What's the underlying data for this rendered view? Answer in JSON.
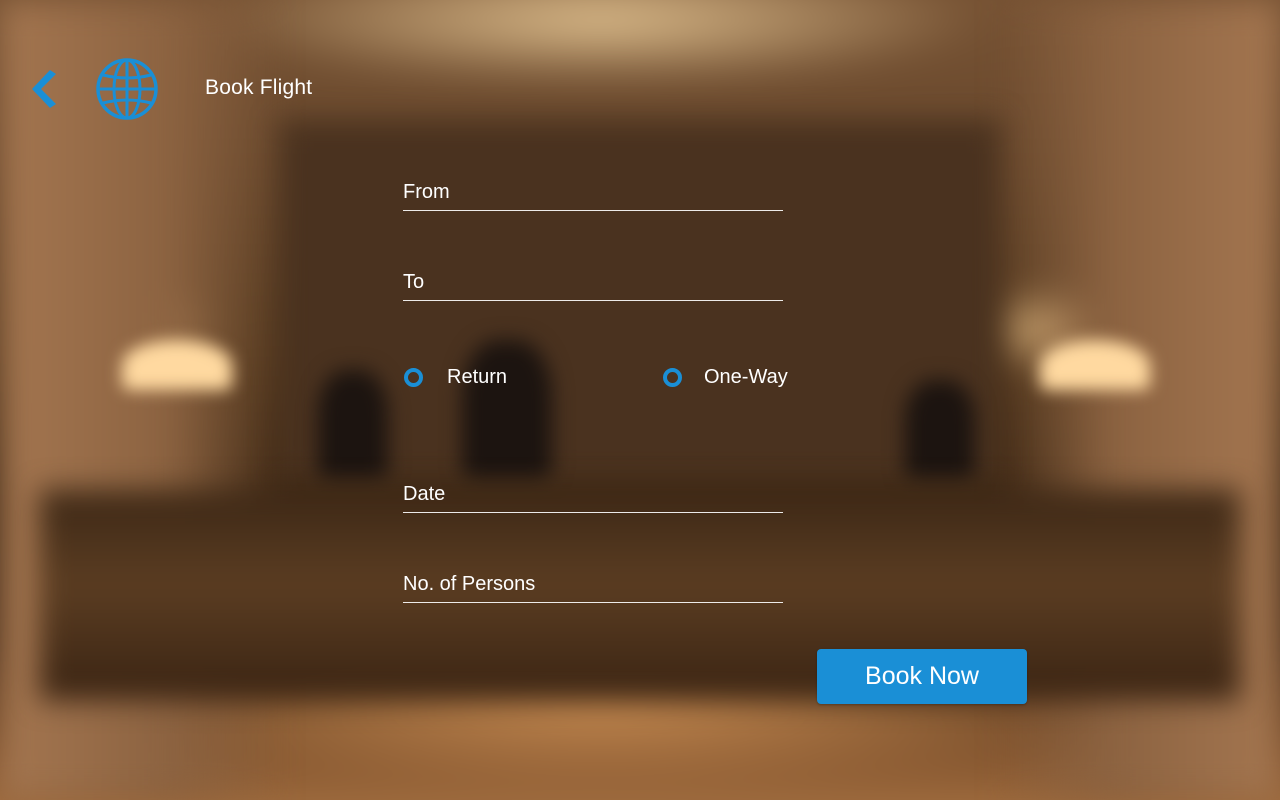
{
  "header": {
    "title": "Book Flight",
    "back_icon": "chevron-left-icon",
    "logo_icon": "globe-icon"
  },
  "form": {
    "from": {
      "placeholder": "From",
      "value": ""
    },
    "to": {
      "placeholder": "To",
      "value": ""
    },
    "trip_type": {
      "options": [
        "Return",
        "One-Way"
      ],
      "selected": ""
    },
    "date": {
      "placeholder": "Date",
      "value": ""
    },
    "persons": {
      "placeholder": "No. of Persons",
      "value": ""
    },
    "submit_label": "Book Now"
  },
  "colors": {
    "accent": "#1a8fd6",
    "text": "#ffffff"
  }
}
